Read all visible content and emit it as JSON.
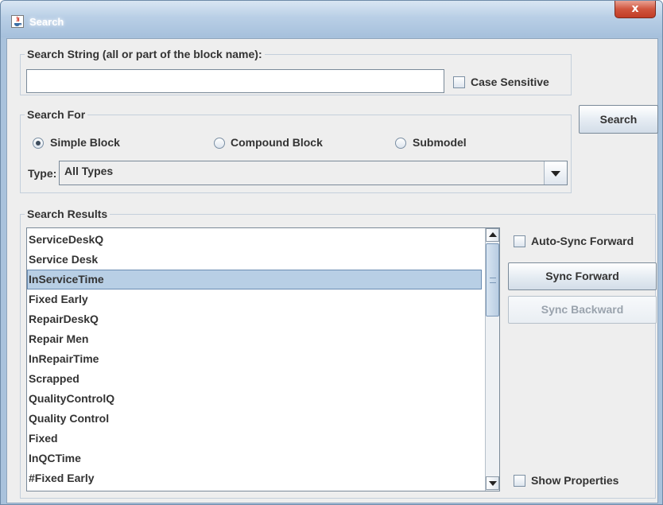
{
  "window": {
    "title": "Search",
    "close_symbol": "x"
  },
  "search_string": {
    "legend": "Search String (all or part of the block name):",
    "input_value": "",
    "case_sensitive_label": "Case Sensitive",
    "case_sensitive_checked": false
  },
  "search_button_label": "Search",
  "search_for": {
    "legend": "Search For",
    "options": [
      "Simple Block",
      "Compound Block",
      "Submodel"
    ],
    "selected": "Simple Block",
    "type_label": "Type:",
    "type_value": "All Types"
  },
  "results": {
    "legend": "Search Results",
    "items": [
      "ServiceDeskQ",
      "Service Desk",
      "InServiceTime",
      "Fixed Early",
      "RepairDeskQ",
      "Repair Men",
      "InRepairTime",
      "Scrapped",
      "QualityControlQ",
      "Quality Control",
      "Fixed",
      "InQCTime",
      "#Fixed Early"
    ],
    "selected_item": "InServiceTime"
  },
  "side_panel": {
    "auto_sync_label": "Auto-Sync Forward",
    "auto_sync_checked": false,
    "sync_forward_label": "Sync Forward",
    "sync_backward_label": "Sync Backward",
    "sync_backward_enabled": false,
    "show_properties_label": "Show Properties",
    "show_properties_checked": false
  }
}
